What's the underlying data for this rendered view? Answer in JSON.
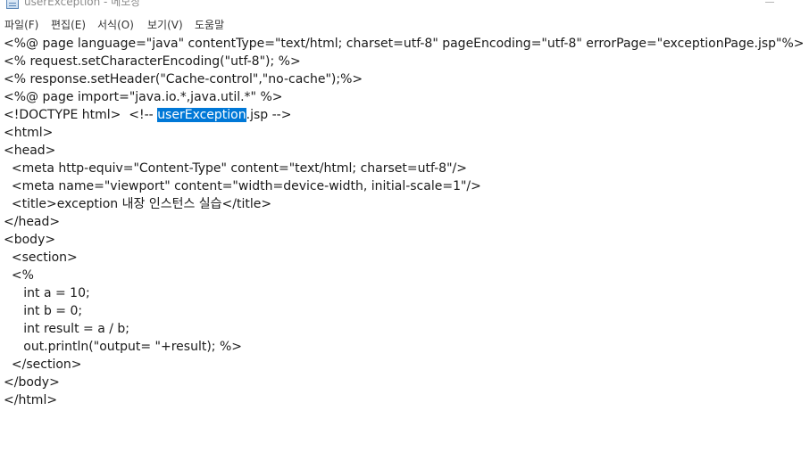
{
  "window": {
    "title": "userException - 메모장"
  },
  "menu": [
    "파일(F)",
    "편집(E)",
    "서식(O)",
    "보기(V)",
    "도움말"
  ],
  "editor": {
    "lines": [
      "<%@ page language=\"java\" contentType=\"text/html; charset=utf-8\" pageEncoding=\"utf-8\" errorPage=\"exceptionPage.jsp\"%>",
      "<% request.setCharacterEncoding(\"utf-8\"); %>",
      "<% response.setHeader(\"Cache-control\",\"no-cache\");%>",
      "<%@ page import=\"java.io.*,java.util.*\" %>",
      "",
      "<html>",
      "<head>",
      "  <meta http-equiv=\"Content-Type\" content=\"text/html; charset=utf-8\"/>",
      "  <meta name=\"viewport\" content=\"width=device-width, initial-scale=1\"/>",
      "  <title>exception 내장 인스턴스 실습</title>",
      "</head>",
      "<body>",
      "  <section>",
      "  <%",
      "     int a = 10;",
      "     int b = 0;",
      "     int result = a / b;",
      "     out.println(\"output= \"+result); %>",
      "  </section>",
      "</body>",
      "</html>"
    ],
    "line5": {
      "before": "<!DOCTYPE html>  <!-- ",
      "selected": "userException",
      "after": ".jsp -->"
    }
  },
  "colors": {
    "selection": "#0078d7",
    "title_text": "#8a8a8a"
  }
}
